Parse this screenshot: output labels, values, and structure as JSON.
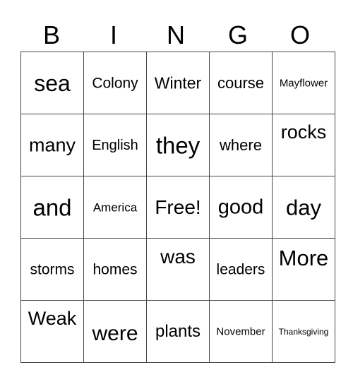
{
  "header": {
    "letters": [
      "B",
      "I",
      "N",
      "G",
      "O"
    ]
  },
  "grid": {
    "rows": [
      [
        "sea",
        "Colony",
        "Winter",
        "course",
        "Mayflower"
      ],
      [
        "many",
        "English",
        "they",
        "where",
        "rocks"
      ],
      [
        "and",
        "America",
        "Free!",
        "good",
        "day"
      ],
      [
        "storms",
        "homes",
        "was",
        "leaders",
        "More"
      ],
      [
        "Weak",
        "were",
        "plants",
        "November",
        "Thanksgiving"
      ]
    ],
    "free_space": "Free!"
  }
}
